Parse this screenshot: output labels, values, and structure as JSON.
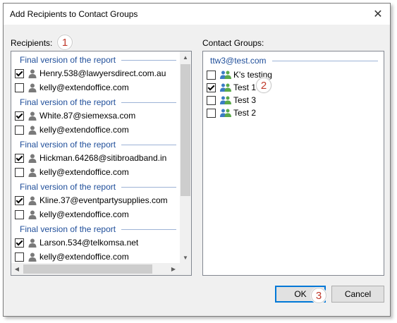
{
  "window": {
    "title": "Add Recipients to Contact Groups",
    "close_glyph": "✕"
  },
  "recipients": {
    "label": "Recipients:",
    "badge": "1",
    "groups": [
      {
        "header": "Final version of the report",
        "rows": [
          {
            "email": "Henry.538@lawyersdirect.com.au",
            "checked": true
          },
          {
            "email": "kelly@extendoffice.com",
            "checked": false
          }
        ]
      },
      {
        "header": "Final version of the report",
        "rows": [
          {
            "email": "White.87@siemexsa.com",
            "checked": true
          },
          {
            "email": "kelly@extendoffice.com",
            "checked": false
          }
        ]
      },
      {
        "header": "Final version of the report",
        "rows": [
          {
            "email": "Hickman.64268@sitibroadband.in",
            "checked": true
          },
          {
            "email": "kelly@extendoffice.com",
            "checked": false
          }
        ]
      },
      {
        "header": "Final version of the report",
        "rows": [
          {
            "email": "Kline.37@eventpartysupplies.com",
            "checked": true
          },
          {
            "email": "kelly@extendoffice.com",
            "checked": false
          }
        ]
      },
      {
        "header": "Final version of the report",
        "rows": [
          {
            "email": "Larson.534@telkomsa.net",
            "checked": true
          },
          {
            "email": "kelly@extendoffice.com",
            "checked": false
          }
        ]
      }
    ]
  },
  "contact_groups": {
    "label": "Contact Groups:",
    "account": "ttw3@test.com",
    "badge": "2",
    "items": [
      {
        "name": "K's testing",
        "checked": false
      },
      {
        "name": "Test 1",
        "checked": true
      },
      {
        "name": "Test 3",
        "checked": false
      },
      {
        "name": "Test 2",
        "checked": false
      }
    ]
  },
  "buttons": {
    "ok": "OK",
    "cancel": "Cancel",
    "ok_badge": "3"
  },
  "scroll_glyphs": {
    "up": "▲",
    "down": "▼",
    "left": "◀",
    "right": "▶"
  },
  "colors": {
    "group_header": "#1f4e9a",
    "badge_text": "#c0392b",
    "accent": "#0078d7"
  },
  "icons": {
    "recipient": "person-icon",
    "contact_group": "contact-group-icon"
  }
}
